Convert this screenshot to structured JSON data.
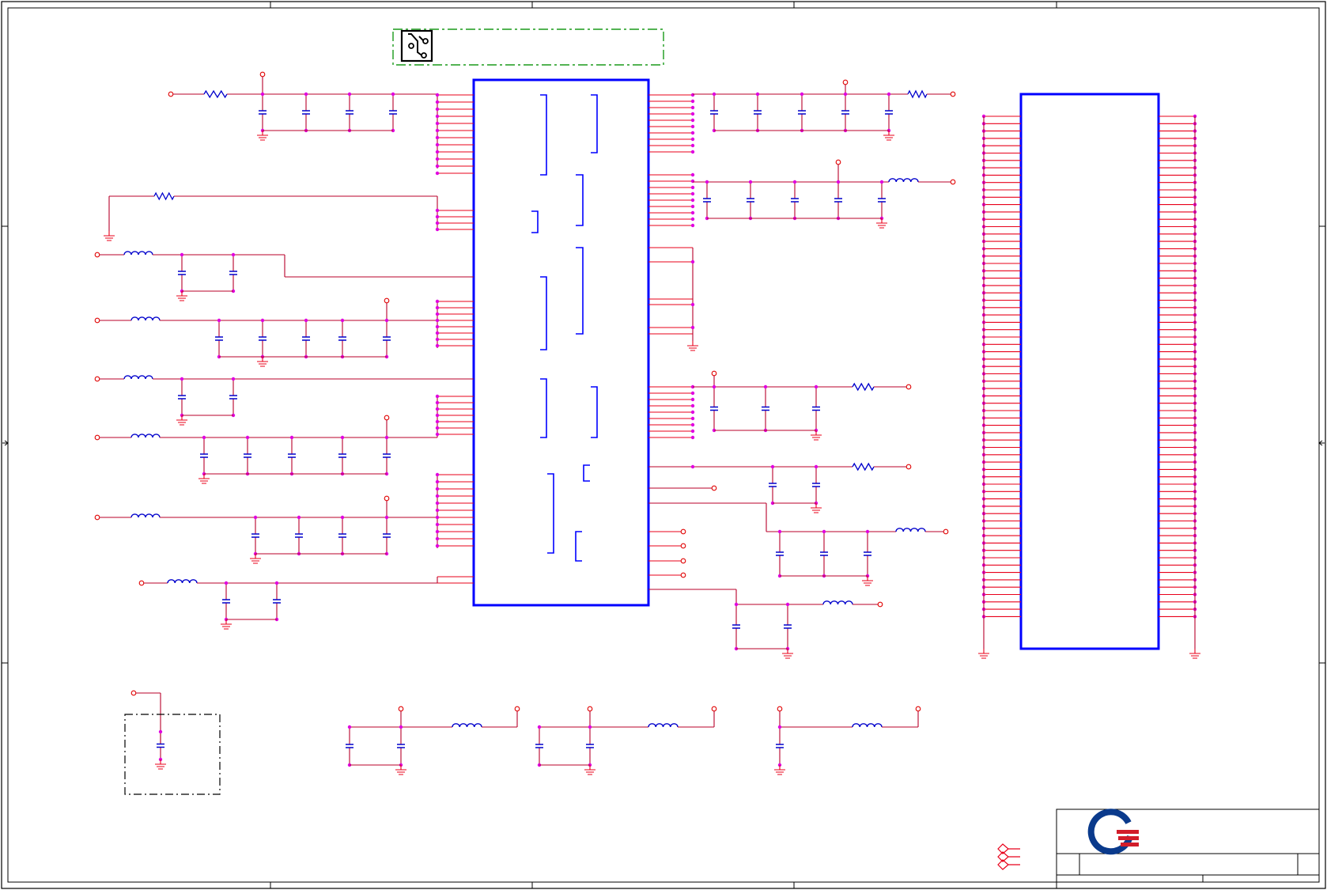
{
  "sheet": {
    "title": "",
    "border_color": "#000000",
    "wire_color": "#b8002a",
    "stub_color": "#e8001a",
    "component_color": "#0000cc",
    "chip_outline_color": "#0000ff",
    "junction_color": "#e000e0",
    "pin_color": "#e00000",
    "keepout_color": "#008a00"
  },
  "ic_main": {
    "label": ""
  },
  "ic_right": {
    "label": ""
  },
  "pcb_note": {
    "label": ""
  },
  "logo": {
    "name": "quanta-logo",
    "colors": [
      "#0a3a8c",
      "#d21d2a"
    ]
  },
  "title_block": {
    "company": "",
    "document": "",
    "rev": ""
  }
}
